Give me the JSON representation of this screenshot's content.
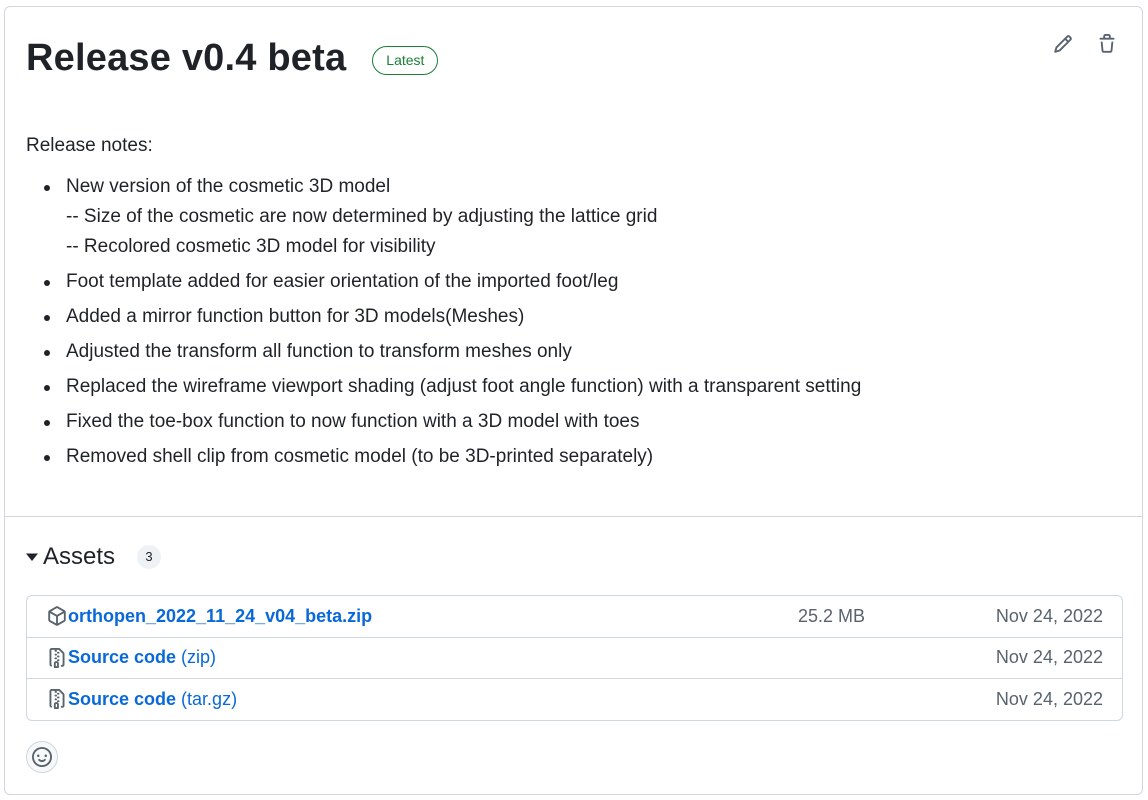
{
  "release": {
    "title": "Release v0.4 beta",
    "badge": "Latest",
    "badge_color": "#1a7f37",
    "actions": {
      "edit_icon": "pencil-icon",
      "delete_icon": "trash-icon"
    }
  },
  "notes": {
    "intro": "Release notes:",
    "items": [
      {
        "text": "New version of the cosmetic 3D model",
        "sub": [
          "-- Size of the cosmetic are now determined by adjusting the lattice grid",
          "-- Recolored cosmetic 3D model for visibility"
        ]
      },
      {
        "text": "Foot template added for easier orientation of the imported foot/leg"
      },
      {
        "text": "Added a mirror function button for 3D models(Meshes)"
      },
      {
        "text": "Adjusted the transform all function to transform meshes only"
      },
      {
        "text": "Replaced the wireframe viewport shading (adjust foot angle function) with a transparent setting"
      },
      {
        "text": "Fixed the toe-box function to now function with a 3D model with toes"
      },
      {
        "text": "Removed shell clip from cosmetic model (to be 3D-printed separately)"
      }
    ]
  },
  "assets": {
    "title": "Assets",
    "count": "3",
    "link_color": "#0969da",
    "rows": [
      {
        "icon": "package-icon",
        "name": "orthopen_2022_11_24_v04_beta.zip",
        "suffix": "",
        "size": "25.2 MB",
        "date": "Nov 24, 2022"
      },
      {
        "icon": "file-zip-icon",
        "name": "Source code",
        "suffix": " (zip)",
        "size": "",
        "date": "Nov 24, 2022"
      },
      {
        "icon": "file-zip-icon",
        "name": "Source code",
        "suffix": " (tar.gz)",
        "size": "",
        "date": "Nov 24, 2022"
      }
    ]
  },
  "reactions": {
    "icon": "smiley-icon"
  }
}
